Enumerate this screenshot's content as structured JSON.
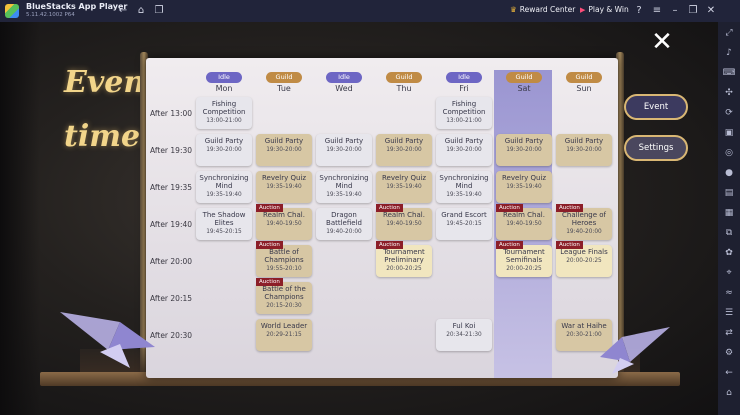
{
  "app": {
    "title": "BlueStacks App Player",
    "version": "5.11.42.1002  P64",
    "reward_center": "Reward Center",
    "play_win": "Play & Win"
  },
  "heading": "Event time:",
  "buttons": {
    "event": "Event",
    "settings": "Settings"
  },
  "days": [
    {
      "tag": "Idle",
      "tag_type": "idle",
      "name": "Mon"
    },
    {
      "tag": "Guild",
      "tag_type": "guild",
      "name": "Tue"
    },
    {
      "tag": "Idle",
      "tag_type": "idle",
      "name": "Wed"
    },
    {
      "tag": "Guild",
      "tag_type": "guild",
      "name": "Thu"
    },
    {
      "tag": "Idle",
      "tag_type": "idle",
      "name": "Fri"
    },
    {
      "tag": "Guild",
      "tag_type": "guild",
      "name": "Sat"
    },
    {
      "tag": "Guild",
      "tag_type": "guild",
      "name": "Sun"
    }
  ],
  "times": [
    "After 13:00",
    "After 19:30",
    "After 19:35",
    "After 19:40",
    "After 20:00",
    "After 20:15",
    "After 20:30"
  ],
  "auction_label": "Auction",
  "events": {
    "mon_1300": {
      "name": "Fishing Competition",
      "time": "13:00-21:00"
    },
    "fri_1300": {
      "name": "Fishing Competition",
      "time": "13:00-21:00"
    },
    "mon_1930": {
      "name": "Guild Party",
      "time": "19:30-20:00"
    },
    "tue_1930": {
      "name": "Guild Party",
      "time": "19:30-20:00"
    },
    "wed_1930": {
      "name": "Guild Party",
      "time": "19:30-20:00"
    },
    "thu_1930": {
      "name": "Guild Party",
      "time": "19:30-20:00"
    },
    "fri_1930": {
      "name": "Guild Party",
      "time": "19:30-20:00"
    },
    "sat_1930": {
      "name": "Guild Party",
      "time": "19:30-20:00"
    },
    "sun_1930": {
      "name": "Guild Party",
      "time": "19:30-20:00"
    },
    "mon_1935": {
      "name": "Synchronizing Mind",
      "time": "19:35-19:40"
    },
    "tue_1935": {
      "name": "Revelry Quiz",
      "time": "19:35-19:40"
    },
    "wed_1935": {
      "name": "Synchronizing Mind",
      "time": "19:35-19:40"
    },
    "thu_1935": {
      "name": "Revelry Quiz",
      "time": "19:35-19:40"
    },
    "fri_1935": {
      "name": "Synchronizing Mind",
      "time": "19:35-19:40"
    },
    "sat_1935": {
      "name": "Revelry Quiz",
      "time": "19:35-19:40"
    },
    "mon_1940": {
      "name": "The Shadow Elites",
      "time": "19:45-20:15"
    },
    "tue_1940": {
      "name": "Realm Chal.",
      "time": "19:40-19:50"
    },
    "wed_1940": {
      "name": "Dragon Battlefield",
      "time": "19:40-20:00"
    },
    "thu_1940": {
      "name": "Realm Chal.",
      "time": "19:40-19:50"
    },
    "fri_1940": {
      "name": "Grand Escort",
      "time": "19:45-20:15"
    },
    "sat_1940": {
      "name": "Realm Chal.",
      "time": "19:40-19:50"
    },
    "sun_1940": {
      "name": "Challenge of Heroes",
      "time": "19:40-20:00"
    },
    "tue_2000": {
      "name": "Battle of Champions",
      "time": "19:55-20:10"
    },
    "thu_2000": {
      "name": "Tournament Preliminary",
      "time": "20:00-20:25"
    },
    "sat_2000": {
      "name": "Tournament Semifinals",
      "time": "20:00-20:25"
    },
    "sun_2000": {
      "name": "League Finals",
      "time": "20:00-20:25"
    },
    "tue_2015": {
      "name": "Battle of the Champions",
      "time": "20:15-20:30"
    },
    "tue_2030": {
      "name": "World Leader",
      "time": "20:29-21:15"
    },
    "fri_2030": {
      "name": "Ful Koi",
      "time": "20:34-21:30"
    },
    "sun_2030": {
      "name": "War at Haihe",
      "time": "20:30-21:00"
    }
  }
}
